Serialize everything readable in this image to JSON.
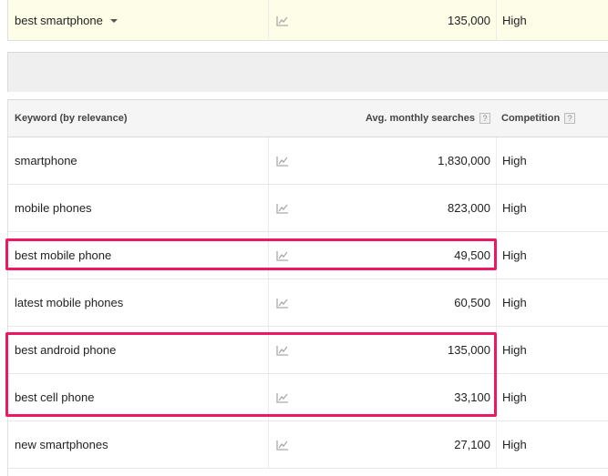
{
  "searched": {
    "keyword": "best smartphone",
    "avg": "135,000",
    "competition": "High"
  },
  "table": {
    "headers": {
      "keyword": "Keyword (by relevance)",
      "avg": "Avg. monthly searches",
      "competition": "Competition",
      "help": "?"
    },
    "rows": [
      {
        "keyword": "smartphone",
        "avg": "1,830,000",
        "competition": "High"
      },
      {
        "keyword": "mobile phones",
        "avg": "823,000",
        "competition": "High"
      },
      {
        "keyword": "best mobile phone",
        "avg": "49,500",
        "competition": "High"
      },
      {
        "keyword": "latest mobile phones",
        "avg": "60,500",
        "competition": "High"
      },
      {
        "keyword": "best android phone",
        "avg": "135,000",
        "competition": "High"
      },
      {
        "keyword": "best cell phone",
        "avg": "33,100",
        "competition": "High"
      },
      {
        "keyword": "new smartphones",
        "avg": "27,100",
        "competition": "High"
      }
    ]
  },
  "icons": {
    "trend": "trend-chart-icon",
    "dropdown": "caret-down-icon"
  },
  "colors": {
    "highlight": "#ee1763",
    "searched_row_bg": "#fdfde8"
  }
}
